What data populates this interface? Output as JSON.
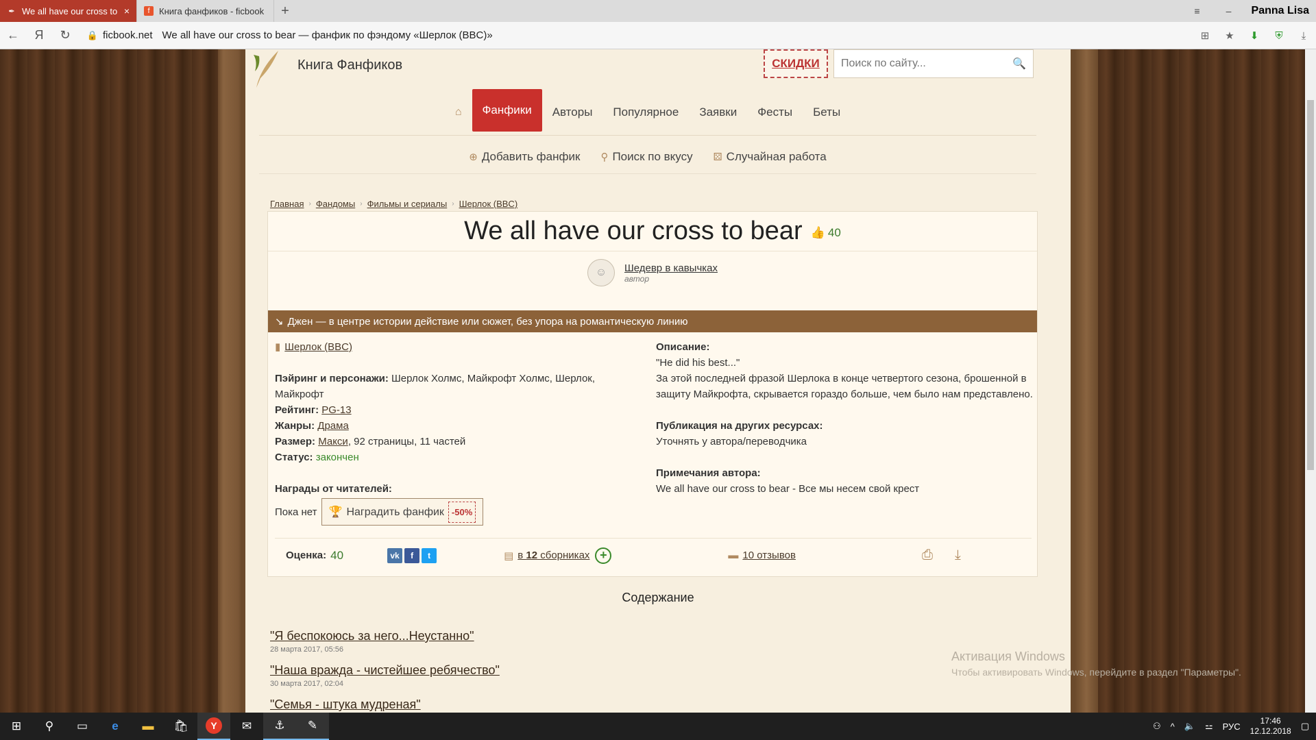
{
  "browser": {
    "tabs": [
      {
        "title": "We all have our cross to bear",
        "active": true
      },
      {
        "title": "Книга фанфиков - ficbook",
        "active": false
      }
    ],
    "profile": "Panna Lisa",
    "url_host": "ficbook.net",
    "page_title": "We all have our cross to bear — фанфик по фэндому «Шерлок (BBC)»"
  },
  "site": {
    "logo": "Книга Фанфиков",
    "sale": "СКИДКИ",
    "search_placeholder": "Поиск по сайту...",
    "nav": [
      "Фанфики",
      "Авторы",
      "Популярное",
      "Заявки",
      "Фесты",
      "Беты"
    ],
    "subnav": [
      "Добавить фанфик",
      "Поиск по вкусу",
      "Случайная работа"
    ]
  },
  "breadcrumb": [
    "Главная",
    "Фандомы",
    "Фильмы и сериалы",
    "Шерлок (BBC)"
  ],
  "fic": {
    "title": "We all have our cross to bear",
    "likes": "40",
    "author": "Шедевр в кавычках",
    "author_role": "автор",
    "direction": "Джен — в центре истории действие или сюжет, без упора на романтическую линию",
    "fandom": "Шерлок (BBC)",
    "pairing_label": "Пэйринг и персонажи:",
    "pairing": "Шерлок Холмс, Майкрофт Холмс, Шерлок, Майкрофт",
    "rating_label": "Рейтинг:",
    "rating": "PG-13",
    "genres_label": "Жанры:",
    "genres": "Драма",
    "size_label": "Размер:",
    "size_link": "Макси",
    "size_rest": ", 92 страницы, 11 частей",
    "status_label": "Статус:",
    "status": "закончен",
    "awards_label": "Награды от читателей:",
    "awards_none": "Пока нет",
    "award_button": "Наградить фанфик",
    "award_discount": "-50%",
    "description_label": "Описание:",
    "description_quote": "\"He did his best...\"",
    "description_text": "За этой последней фразой Шерлока в конце четвертого сезона, брошенной в защиту Майкрофта, скрывается гораздо больше, чем было нам представлено.",
    "other_label": "Публикация на других ресурсах:",
    "other_text": "Уточнять у автора/переводчика",
    "notes_label": "Примечания автора:",
    "notes_text": "We all have our cross to bear - Все мы несем свой крест",
    "score_label": "Оценка:",
    "score": "40",
    "collections_prefix": "в ",
    "collections_count": "12",
    "collections_suffix": " сборниках",
    "reviews": "10 отзывов"
  },
  "toc": {
    "title": "Содержание",
    "chapters": [
      {
        "title": "\"Я беспокоюсь за него...Неустанно\"",
        "date": "28 марта 2017, 05:56"
      },
      {
        "title": "\"Наша вражда - чистейшее ребячество\"",
        "date": "30 марта 2017, 02:04"
      },
      {
        "title": "\"Семья - штука мудреная\"",
        "date": ""
      }
    ]
  },
  "watermark": {
    "line1": "Активация Windows",
    "line2": "Чтобы активировать Windows, перейдите в раздел \"Параметры\"."
  },
  "taskbar": {
    "lang": "РУС",
    "time": "17:46",
    "date": "12.12.2018"
  },
  "colors": {
    "accent": "#c9302c",
    "bar": "#8c6239",
    "green": "#3b7a2b"
  }
}
